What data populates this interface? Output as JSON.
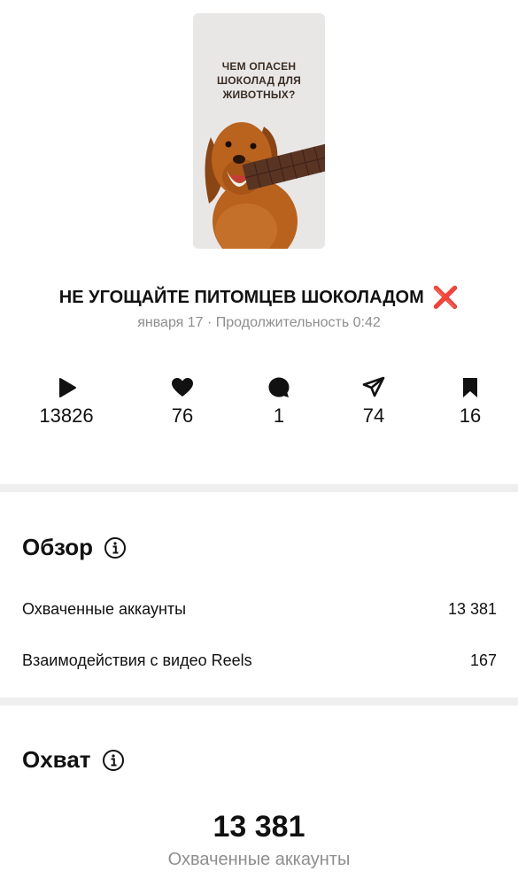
{
  "thumbnail": {
    "caption": "ЧЕМ ОПАСЕН\nШОКОЛАД ДЛЯ\nЖИВОТНЫХ?"
  },
  "reel": {
    "title": "НЕ УГОЩАЙТЕ ПИТОМЦЕВ ШОКОЛАДОМ",
    "title_emoji": "❌",
    "meta": "января 17 · Продолжительность 0:42"
  },
  "stats": {
    "plays": "13826",
    "likes": "76",
    "comments": "1",
    "shares": "74",
    "saves": "16"
  },
  "overview": {
    "title": "Обзор",
    "rows": [
      {
        "label": "Охваченные аккаунты",
        "value": "13 381"
      },
      {
        "label": "Взаимодействия с видео Reels",
        "value": "167"
      }
    ]
  },
  "reach": {
    "title": "Охват",
    "value": "13 381",
    "label": "Охваченные аккаунты"
  },
  "colors": {
    "accent_red": "#e3202b",
    "muted": "#8e8e8e",
    "divider": "#efefef"
  }
}
